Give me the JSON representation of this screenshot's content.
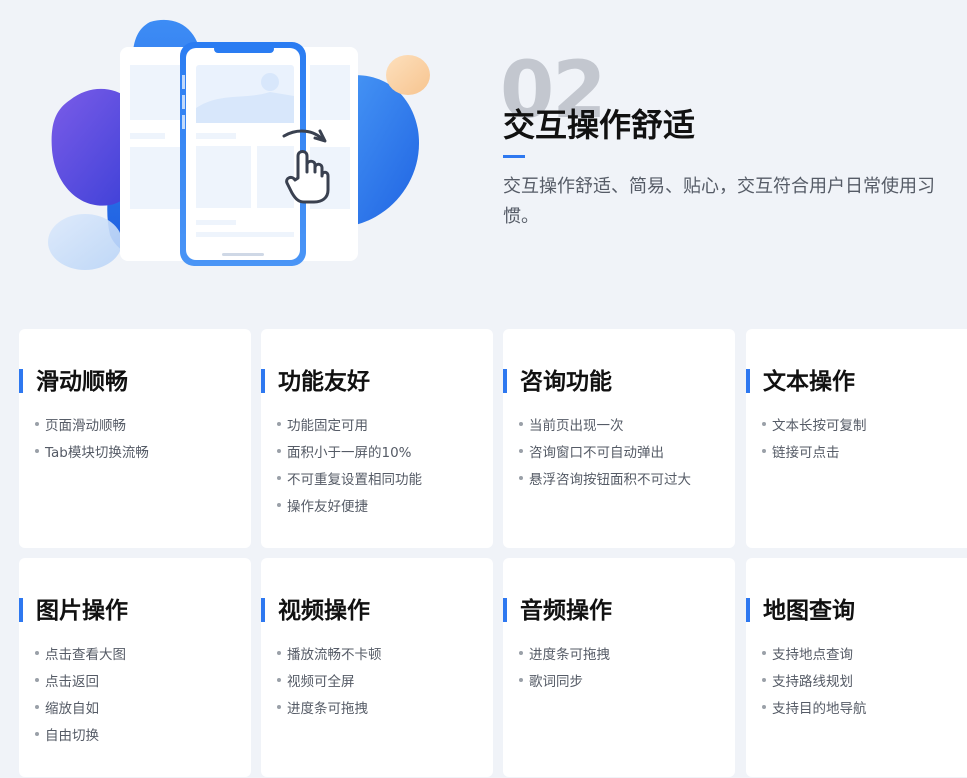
{
  "hero": {
    "number": "02",
    "title": "交互操作舒适",
    "description": "交互操作舒适、简易、贴心，交互符合用户日常使用习惯。",
    "illustration_icon": "phone-swipe-hand-icon"
  },
  "colors": {
    "accent": "#2e78f0",
    "background": "#f0f3f8",
    "card": "#ffffff",
    "title": "#111111",
    "text": "#555b66",
    "number": "#c3c7cf"
  },
  "cards": [
    {
      "title": "滑动顺畅",
      "items": [
        "页面滑动顺畅",
        "Tab模块切换流畅"
      ]
    },
    {
      "title": "功能友好",
      "items": [
        "功能固定可用",
        "面积小于一屏的10%",
        "不可重复设置相同功能",
        "操作友好便捷"
      ]
    },
    {
      "title": "咨询功能",
      "items": [
        "当前页出现一次",
        "咨询窗口不可自动弹出",
        "悬浮咨询按钮面积不可过大"
      ]
    },
    {
      "title": "文本操作",
      "items": [
        "文本长按可复制",
        "链接可点击"
      ]
    },
    {
      "title": "图片操作",
      "items": [
        "点击查看大图",
        "点击返回",
        "缩放自如",
        "自由切换"
      ]
    },
    {
      "title": "视频操作",
      "items": [
        "播放流畅不卡顿",
        "视频可全屏",
        "进度条可拖拽"
      ]
    },
    {
      "title": "音频操作",
      "items": [
        "进度条可拖拽",
        "歌词同步"
      ]
    },
    {
      "title": "地图查询",
      "items": [
        "支持地点查询",
        "支持路线规划",
        "支持目的地导航"
      ]
    }
  ]
}
